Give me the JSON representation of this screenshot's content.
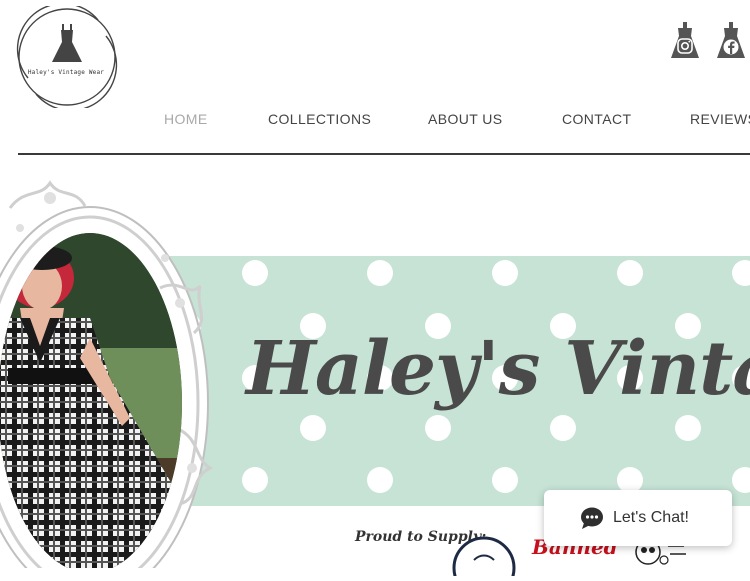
{
  "brand": {
    "logo_text": "Haley's Vintage Wear"
  },
  "social": {
    "instagram_icon": "instagram-icon",
    "facebook_icon": "facebook-icon"
  },
  "nav": {
    "items": [
      {
        "label": "HOME",
        "active": true
      },
      {
        "label": "COLLECTIONS",
        "active": false
      },
      {
        "label": "ABOUT US",
        "active": false
      },
      {
        "label": "CONTACT",
        "active": false
      },
      {
        "label": "REVIEWS",
        "active": false
      }
    ]
  },
  "hero": {
    "title": "Haley's Vintage Wear",
    "background_color": "#c6e3d6",
    "dot_color": "#ffffff"
  },
  "supply": {
    "heading": "Proud to Supply:",
    "brand_banned": "Banned"
  },
  "chat": {
    "label": "Let's Chat!",
    "icon": "chat-bubble-icon"
  },
  "colors": {
    "nav_text": "#444444",
    "nav_active": "#a9a9a9",
    "title_text": "#4a4a4a",
    "banned_red": "#c8101c"
  }
}
